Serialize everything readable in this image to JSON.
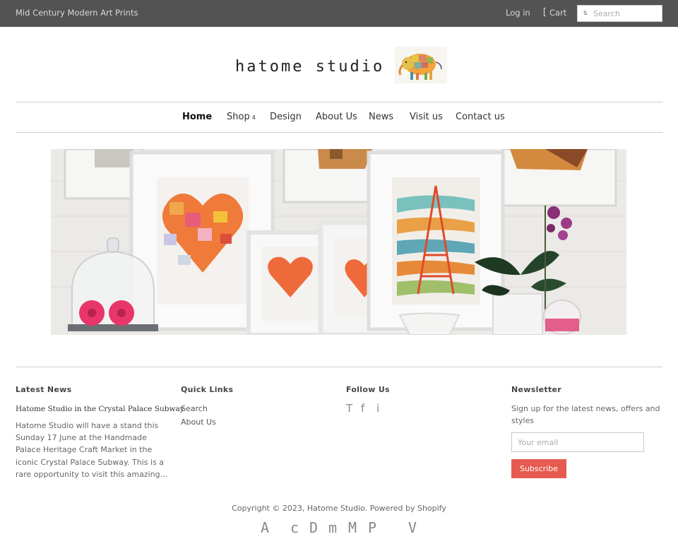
{
  "topbar": {
    "tagline": "Mid Century Modern Art Prints",
    "login_label": "Log in",
    "cart_icon_glyph": "[",
    "cart_label": "Cart",
    "search_icon_glyph": "s",
    "search_placeholder": "Search",
    "background": "#535353"
  },
  "logo": {
    "text": "hatome studio",
    "icon": "elephant-logo-icon"
  },
  "nav": {
    "items": [
      {
        "label": "Home",
        "active": true
      },
      {
        "label": "Shop",
        "caret": "4"
      },
      {
        "label": "Design"
      },
      {
        "label": "About Us"
      },
      {
        "label": "News"
      },
      {
        "label": "Visit us"
      },
      {
        "label": "Contact us"
      }
    ]
  },
  "hero": {
    "description": ""
  },
  "footer": {
    "latest_news": {
      "title": "Latest News",
      "article_title": "Hatome Studio in the Crystal Palace Subway",
      "article_excerpt": "Hatome Studio will have a stand this Sunday 17 June at the Handmade Palace Heritage Craft Market in the iconic Crystal Palace Subway. This is a rare opportunity to visit this amazing..."
    },
    "quick_links": {
      "title": "Quick Links",
      "links": [
        "Search",
        "About Us"
      ]
    },
    "follow_us": {
      "title": "Follow Us",
      "icons": [
        {
          "glyph": "T",
          "name": "twitter-icon"
        },
        {
          "glyph": "f",
          "name": "facebook-icon"
        },
        {
          "glyph": "i",
          "name": "instagram-icon"
        }
      ]
    },
    "newsletter": {
      "title": "Newsletter",
      "text": "Sign up for the latest news, offers and styles",
      "email_placeholder": "Your email",
      "button_label": "Subscribe",
      "button_color": "#e85a50"
    },
    "copyright": "Copyright © 2023, Hatome Studio. Powered by Shopify",
    "payment_icons": [
      {
        "glyph": "A",
        "name": "american-express-icon"
      },
      {
        "glyph": "c",
        "name": "apple-pay-icon"
      },
      {
        "glyph": "D",
        "name": "diners-club-icon"
      },
      {
        "glyph": "m",
        "name": "maestro-icon"
      },
      {
        "glyph": "M",
        "name": "mastercard-icon"
      },
      {
        "glyph": "P",
        "name": "paypal-icon"
      },
      {
        "glyph": "V",
        "name": "visa-icon"
      }
    ]
  }
}
